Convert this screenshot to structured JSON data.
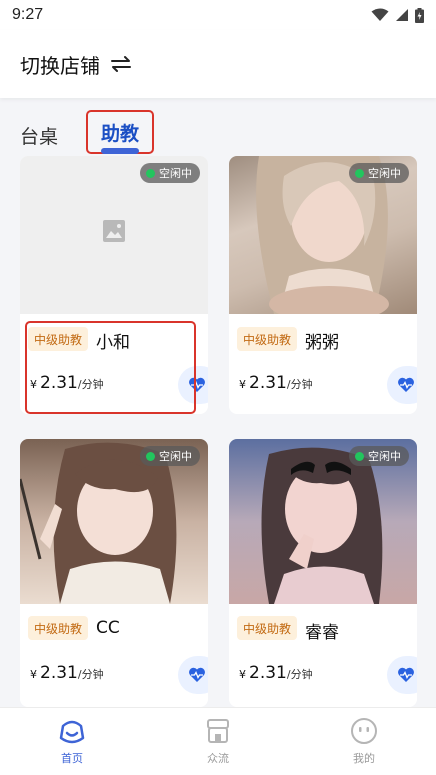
{
  "status_bar": {
    "time": "9:27"
  },
  "header": {
    "title": "切换店铺"
  },
  "tabs": [
    {
      "label": "台桌",
      "active": false
    },
    {
      "label": "助教",
      "active": true
    }
  ],
  "cards": [
    {
      "status": "空闲中",
      "level": "中级助教",
      "name": "小和",
      "currency": "¥",
      "price": "2.31",
      "unit": "/分钟",
      "photo": "placeholder-image"
    },
    {
      "status": "空闲中",
      "level": "中级助教",
      "name": "粥粥",
      "currency": "¥",
      "price": "2.31",
      "unit": "/分钟",
      "photo": "portrait"
    },
    {
      "status": "空闲中",
      "level": "中级助教",
      "name": "CC",
      "currency": "¥",
      "price": "2.31",
      "unit": "/分钟",
      "photo": "portrait"
    },
    {
      "status": "空闲中",
      "level": "中级助教",
      "name": "睿睿",
      "currency": "¥",
      "price": "2.31",
      "unit": "/分钟",
      "photo": "portrait"
    }
  ],
  "bottom_nav": [
    {
      "label": "首页",
      "icon": "home-face-icon",
      "active": true
    },
    {
      "label": "众流",
      "icon": "shop-icon",
      "active": false
    },
    {
      "label": "我的",
      "icon": "profile-face-icon",
      "active": false
    }
  ],
  "colors": {
    "accent": "#3e64d6",
    "highlight_box": "#d9342b",
    "status_dot": "#22c55e",
    "level_tag_bg": "#fdf0dc",
    "level_tag_text": "#c26a13"
  }
}
